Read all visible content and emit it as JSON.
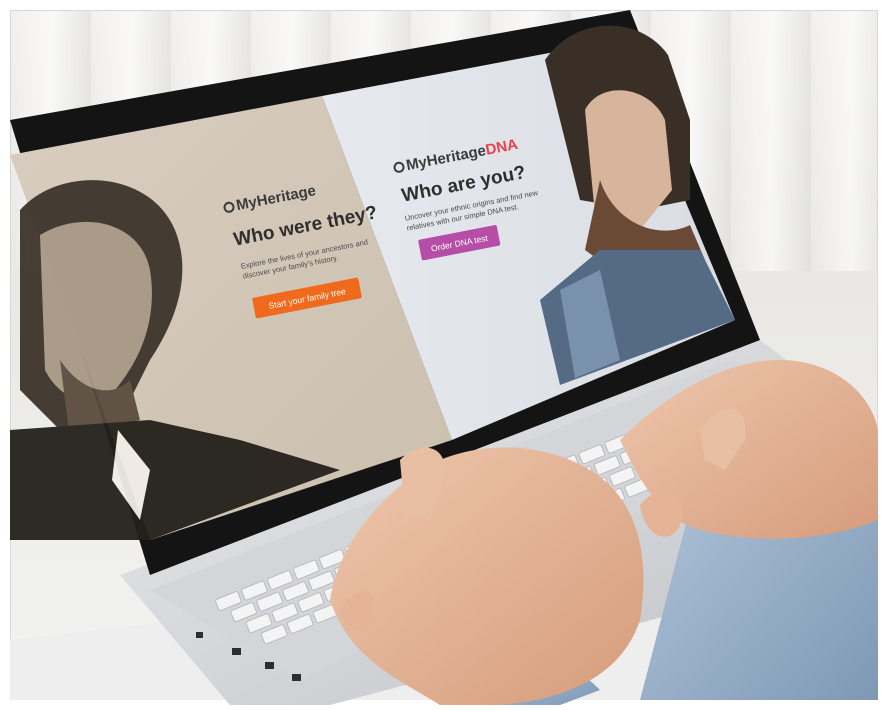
{
  "left_panel": {
    "brand": "MyHeritage",
    "headline": "Who were they?",
    "subtitle_line1": "Explore the lives of your ancestors and",
    "subtitle_line2": "discover your family's history.",
    "cta_label": "Start your family tree",
    "cta_color": "#f06a1e"
  },
  "right_panel": {
    "brand": "MyHeritage",
    "brand_suffix": "DNA",
    "headline": "Who are you?",
    "subtitle_line1": "Uncover your ethnic origins and find new",
    "subtitle_line2": "relatives with our simple DNA test.",
    "cta_label": "Order DNA test",
    "cta_color": "#b64ea7",
    "dna_color": "#ef3e4a"
  }
}
